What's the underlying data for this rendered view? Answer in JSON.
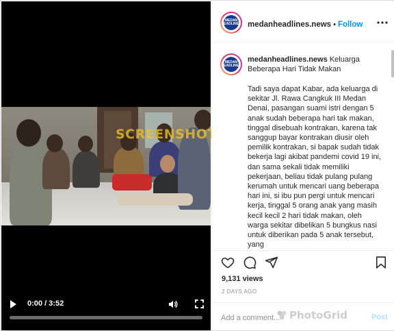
{
  "video": {
    "current_time": "0:00",
    "duration": "3:52",
    "time_display": "0:00 / 3:52",
    "progress_fraction": 0.0,
    "watermark_text": "SCREENSHOT BY"
  },
  "post": {
    "account": {
      "username": "medanheadlines.news",
      "avatar_text": "MEDAN HEADLINES"
    },
    "separator": "•",
    "follow_label": "Follow",
    "caption": {
      "username": "medanheadlines.news",
      "title": "Keluarga Beberapa Hari Tidak Makan",
      "body": "Tadi saya dapat Kabar, ada keluarga di sekitar Jl. Rawa Cangkuk III Medan Denai, pasangan suami istri dengan 5 anak sudah beberapa hari tak makan, tinggal disebuah kontrakan, karena tak sanggup bayar kontrakan diusir oleh pemilik kontrakan, si bapak sudah tidak bekerja lagi akibat pandemi covid 19 ini, dan sama sekali tidak memiliki pekerjaan, beliau tidak pulang pulang kerumah untuk mencari uang beberapa hari ini, si ibu pun pergi untuk mencari kerja, tinggal 5 orang anak yang masih kecil kecil 2 hari tidak makan, oleh warga sekitar dibelikan 5 bungkus nasi untuk diberikan pada 5 anak tersebut, yang"
    },
    "views": "9,131 views",
    "date": "2 DAYS AGO",
    "comment_placeholder": "Add a comment...",
    "post_label": "Post",
    "photogrid_watermark": "PhotoGrid"
  },
  "icons": {
    "like": "heart-icon",
    "comment": "comment-icon",
    "share": "paper-plane-icon",
    "save": "bookmark-icon",
    "more": "more-dots-icon",
    "play": "play-icon",
    "volume": "volume-icon",
    "fullscreen": "fullscreen-icon"
  },
  "colors": {
    "link_blue": "#0095f6",
    "post_disabled": "#b2dffc",
    "watermark_yellow": "#f0c41e"
  }
}
